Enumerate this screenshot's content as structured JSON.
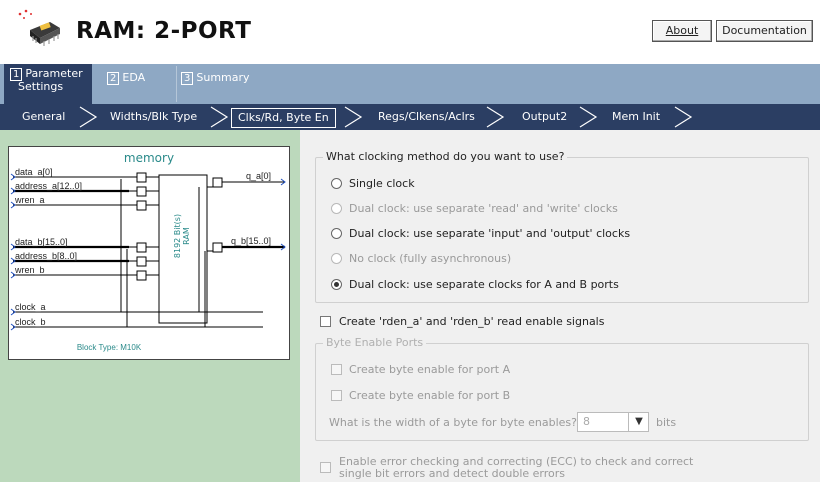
{
  "header": {
    "title": "RAM: 2-PORT",
    "about_label": "About",
    "docs_label": "Documentation",
    "logo_icon": "ram-chip-icon"
  },
  "tabs": [
    {
      "num": "1",
      "label_line1": "Parameter",
      "label_line2": "Settings"
    },
    {
      "num": "2",
      "label_line1": "EDA",
      "label_line2": ""
    },
    {
      "num": "3",
      "label_line1": "Summary",
      "label_line2": ""
    }
  ],
  "crumbs": [
    "General",
    "Widths/Blk Type",
    "Clks/Rd, Byte En",
    "Regs/Clkens/Aclrs",
    "Output2",
    "Mem Init"
  ],
  "diagram": {
    "title": "memory",
    "inputs": [
      "data_a[0]",
      "address_a[12..0]",
      "wren_a",
      "data_b[15..0]",
      "address_b[8..0]",
      "wren_b",
      "clock_a",
      "clock_b"
    ],
    "outputs": [
      "q_a[0]",
      "q_b[15..0]"
    ],
    "block_label": "8192 Bit(s)",
    "block_label2": "RAM",
    "block_type": "Block Type: M10K"
  },
  "clocking": {
    "question": "What clocking method do you want to use?",
    "options": [
      {
        "label": "Single clock",
        "enabled": true,
        "selected": false
      },
      {
        "label": "Dual clock: use separate 'read' and 'write' clocks",
        "enabled": false,
        "selected": false
      },
      {
        "label": "Dual clock: use separate 'input' and 'output' clocks",
        "enabled": true,
        "selected": false
      },
      {
        "label": "No clock (fully asynchronous)",
        "enabled": false,
        "selected": false
      },
      {
        "label": "Dual clock: use separate clocks for A and B ports",
        "enabled": true,
        "selected": true
      }
    ]
  },
  "rden_label": "Create 'rden_a' and 'rden_b' read enable signals",
  "byte_enable": {
    "legend": "Byte Enable Ports",
    "port_a": "Create byte enable for port A",
    "port_b": "Create byte enable for port B",
    "width_question": "What is the width of a byte for byte enables?",
    "width_value": "8",
    "width_unit": "bits"
  },
  "ecc": {
    "line1": "Enable error checking and correcting (ECC) to check and correct",
    "line2": "single bit errors and detect double errors"
  },
  "colors": {
    "nav_dark": "#2b3e63",
    "tab_bar": "#8ea8c4",
    "left_panel": "#bcd9bc",
    "diagram_title": "#2a8a8a"
  }
}
